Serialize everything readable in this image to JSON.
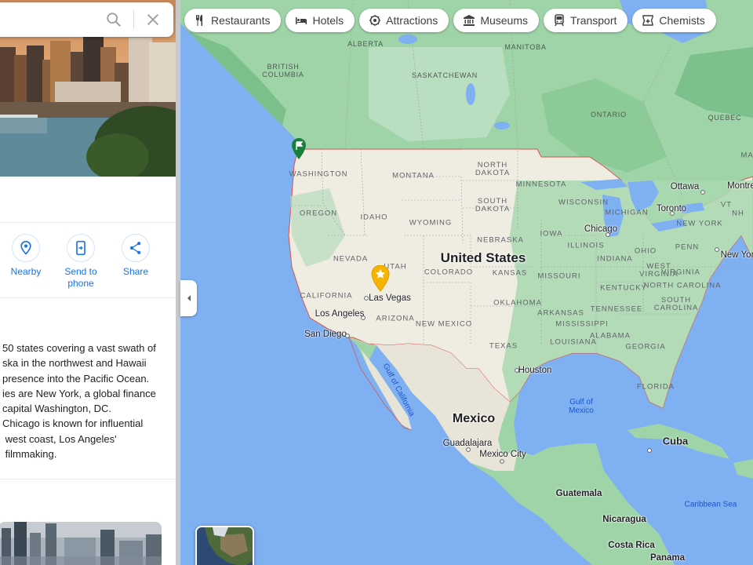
{
  "search": {
    "query": ""
  },
  "panel": {
    "actions": [
      {
        "label": "Nearby",
        "icon": "nearby-icon"
      },
      {
        "label": "Send to\nphone",
        "icon": "send-to-phone-icon"
      },
      {
        "label": "Share",
        "icon": "share-icon"
      }
    ],
    "description_lines": [
      "50 states covering a vast swath of",
      "ska in the northwest and Hawaii",
      "presence into the Pacific Ocean.",
      "ies are New York, a global finance",
      "capital Washington, DC.",
      "Chicago is known for influential",
      " west coast, Los Angeles'",
      " filmmaking."
    ]
  },
  "chips": [
    {
      "label": "Restaurants",
      "icon": "restaurant-icon"
    },
    {
      "label": "Hotels",
      "icon": "hotel-icon"
    },
    {
      "label": "Attractions",
      "icon": "attractions-icon"
    },
    {
      "label": "Museums",
      "icon": "museum-icon"
    },
    {
      "label": "Transport",
      "icon": "transport-icon"
    },
    {
      "label": "Chemists",
      "icon": "chemist-icon"
    }
  ],
  "map": {
    "country_label": "United States",
    "mexico_label": "Mexico",
    "province_labels": [
      "ALBERTA",
      "BRITISH\nCOLUMBIA",
      "SASKATCHEWAN",
      "MANITOBA",
      "ONTARIO",
      "QUEBEC"
    ],
    "state_labels": [
      "WASHINGTON",
      "OREGON",
      "CALIFORNIA",
      "NEVADA",
      "IDAHO",
      "MONTANA",
      "WYOMING",
      "UTAH",
      "ARIZONA",
      "COLORADO",
      "NEW MEXICO",
      "NORTH\nDAKOTA",
      "SOUTH\nDAKOTA",
      "NEBRASKA",
      "KANSAS",
      "OKLAHOMA",
      "TEXAS",
      "MINNESOTA",
      "IOWA",
      "MISSOURI",
      "ARKANSAS",
      "LOUISIANA",
      "WISCONSIN",
      "ILLINOIS",
      "MICHIGAN",
      "INDIANA",
      "OHIO",
      "KENTUCKY",
      "TENNESSEE",
      "MISSISSIPPI",
      "ALABAMA",
      "GEORGIA",
      "FLORIDA",
      "SOUTH\nCAROLINA",
      "NORTH\nCAROLINA",
      "VIRGINIA",
      "WEST\nVIRGINIA",
      "PENN",
      "NEW YORK",
      "VT",
      "NH",
      "MAINE"
    ],
    "city_labels": [
      "Las Vegas",
      "Los Angeles",
      "San Diego",
      "Chicago",
      "Houston",
      "Toronto",
      "Ottawa",
      "Montre",
      "New Yor",
      "Guadalajara",
      "Mexico City",
      "Cuba",
      "Guatemala",
      "Nicaragua",
      "Costa Rica",
      "Panama"
    ],
    "water_labels": [
      "Gulf of\nMexico",
      "Caribbean Sea",
      "Gulf of California"
    ],
    "colors": {
      "water": "#7fb0f2",
      "land": "#9fd4a8",
      "land_dark": "#7cc18c",
      "us_land": "#efece1",
      "mexico_land": "#e9e4d8",
      "border": "#d9534f"
    }
  }
}
